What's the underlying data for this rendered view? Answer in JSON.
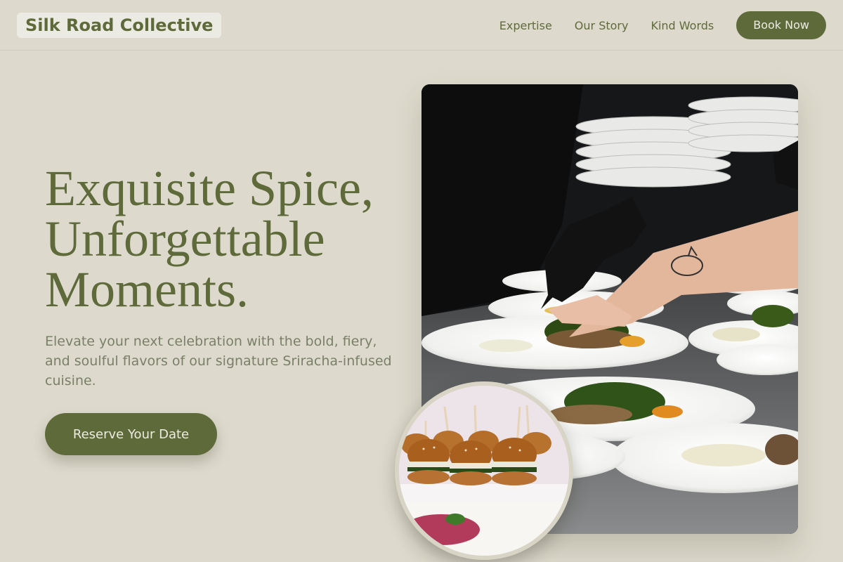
{
  "header": {
    "brand": "Silk Road Collective",
    "nav": [
      "Expertise",
      "Our Story",
      "Kind Words"
    ],
    "cta": "Book Now"
  },
  "hero": {
    "title_lines": [
      "Exquisite Spice,",
      "Unforgettable",
      "Moments."
    ],
    "subtitle": "Elevate your next celebration with the bold, fiery, and soulful flavors of our signature Sriracha-infused cuisine.",
    "cta": "Reserve Your Date"
  },
  "colors": {
    "background": "#dddacd",
    "accent": "#5f6a3a",
    "accent_text": "#ecebe3",
    "muted_text": "#7a7f68"
  },
  "images": {
    "main": "chef-plating-photo",
    "circle": "sliders-photo"
  }
}
